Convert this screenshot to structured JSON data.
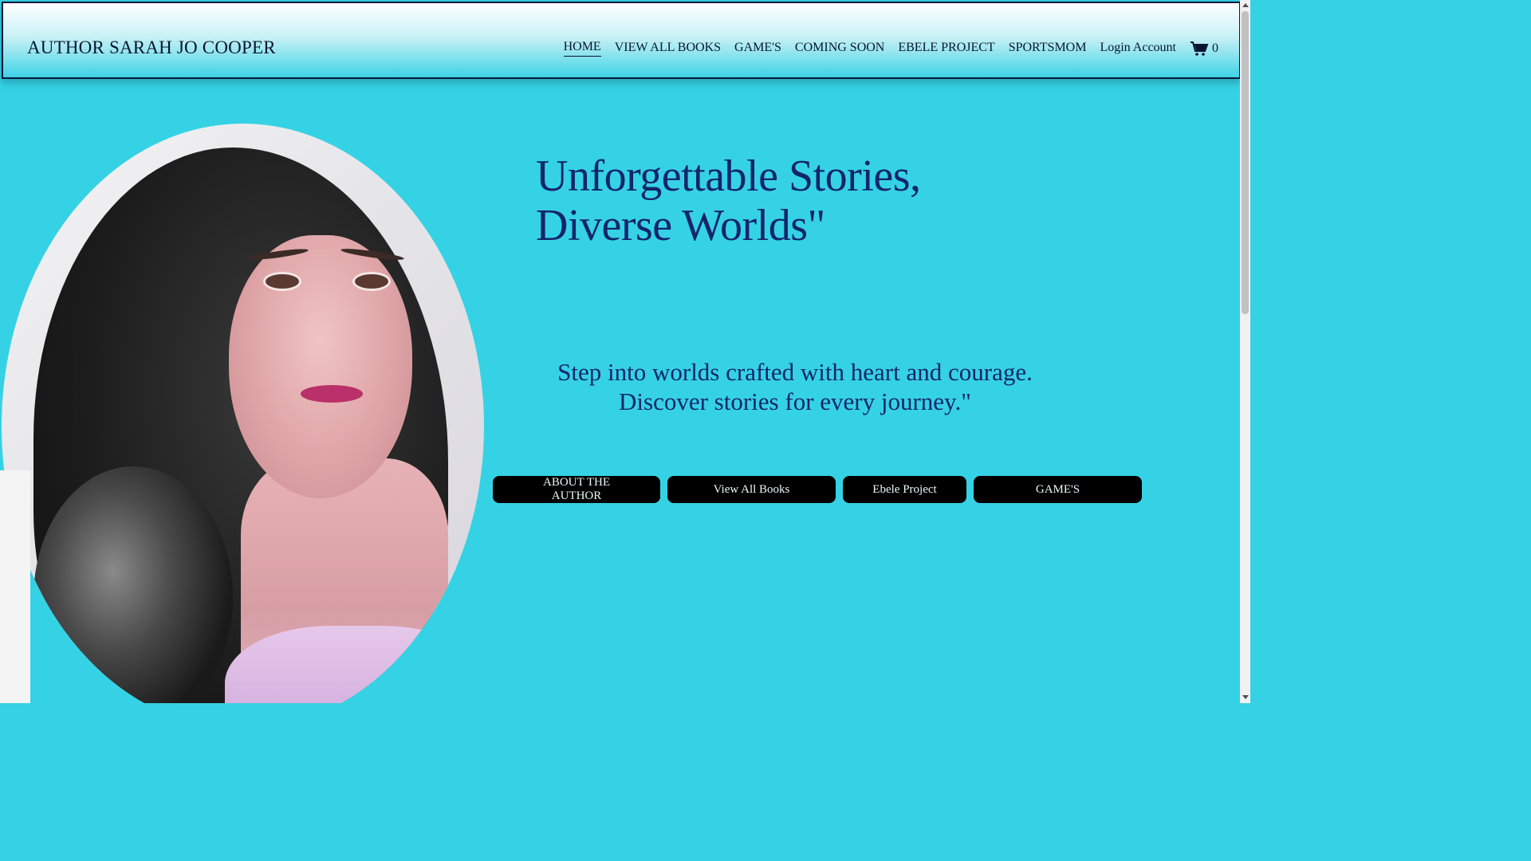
{
  "header": {
    "site_title": "AUTHOR SARAH JO COOPER",
    "nav": [
      {
        "label": "HOME",
        "active": true
      },
      {
        "label": "VIEW ALL BOOKS"
      },
      {
        "label": "GAME'S"
      },
      {
        "label": "COMING SOON"
      },
      {
        "label": "EBELE PROJECT"
      },
      {
        "label": "SPORTSMOM"
      },
      {
        "label": "Login Account"
      }
    ],
    "cart": {
      "icon": "shopping-cart-icon",
      "count": "0"
    }
  },
  "hero": {
    "headline_line1": "Unforgettable Stories,",
    "headline_line2": "Diverse Worlds\"",
    "subtext_line1": "Step into worlds crafted with heart and courage.",
    "subtext_line2": "Discover stories for every journey.\"",
    "buttons": [
      {
        "line1": "ABOUT THE",
        "line2": "AUTHOR"
      },
      {
        "label": "View All Books"
      },
      {
        "label": "Ebele Project"
      },
      {
        "label": "GAME'S"
      }
    ]
  },
  "colors": {
    "background": "#35d2e5",
    "heading": "#13256a",
    "button": "#000000"
  }
}
